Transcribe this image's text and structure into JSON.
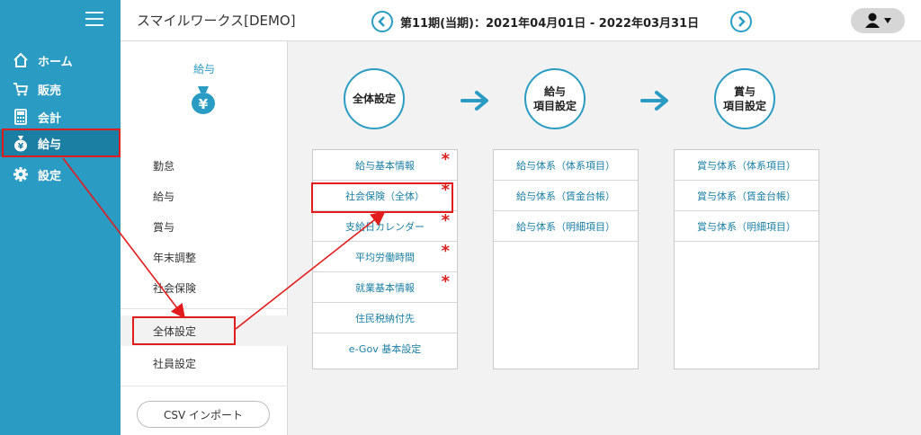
{
  "colors": {
    "accent": "#2a9bc2",
    "accent_dark": "#1a7fa3",
    "required": "#d62020",
    "annotation": "#e21c1c"
  },
  "leftnav": {
    "items": [
      {
        "label": "ホーム",
        "icon": "home-icon"
      },
      {
        "label": "販売",
        "icon": "cart-icon"
      },
      {
        "label": "会計",
        "icon": "calculator-icon"
      },
      {
        "label": "給与",
        "icon": "money-bag-icon"
      },
      {
        "label": "設定",
        "icon": "gear-icon"
      }
    ]
  },
  "topbar": {
    "company": "スマイルワークス[DEMO]",
    "period": "第11期(当期)：2021年04月01日 - 2022年03月31日"
  },
  "subnav": {
    "title": "給与",
    "items": [
      "勤怠",
      "給与",
      "賞与",
      "年末調整",
      "社会保険",
      "全体設定",
      "社員設定"
    ],
    "csv_button": "CSV インポート"
  },
  "main": {
    "steps": [
      {
        "line1": "全体設定",
        "line2": ""
      },
      {
        "line1": "給与",
        "line2": "項目設定"
      },
      {
        "line1": "賞与",
        "line2": "項目設定"
      }
    ],
    "panel1": [
      {
        "label": "給与基本情報",
        "required": "*"
      },
      {
        "label": "社会保険（全体）",
        "required": "*"
      },
      {
        "label": "支給日カレンダー",
        "required": "*"
      },
      {
        "label": "平均労働時間",
        "required": "*"
      },
      {
        "label": "就業基本情報",
        "required": "*"
      },
      {
        "label": "住民税納付先",
        "required": ""
      },
      {
        "label": "e-Gov 基本設定",
        "required": ""
      }
    ],
    "panel2": [
      {
        "label": "給与体系（体系項目）"
      },
      {
        "label": "給与体系（賃金台帳）"
      },
      {
        "label": "給与体系（明細項目）"
      }
    ],
    "panel3": [
      {
        "label": "賞与体系（体系項目）"
      },
      {
        "label": "賞与体系（賃金台帳）"
      },
      {
        "label": "賞与体系（明細項目）"
      }
    ]
  }
}
